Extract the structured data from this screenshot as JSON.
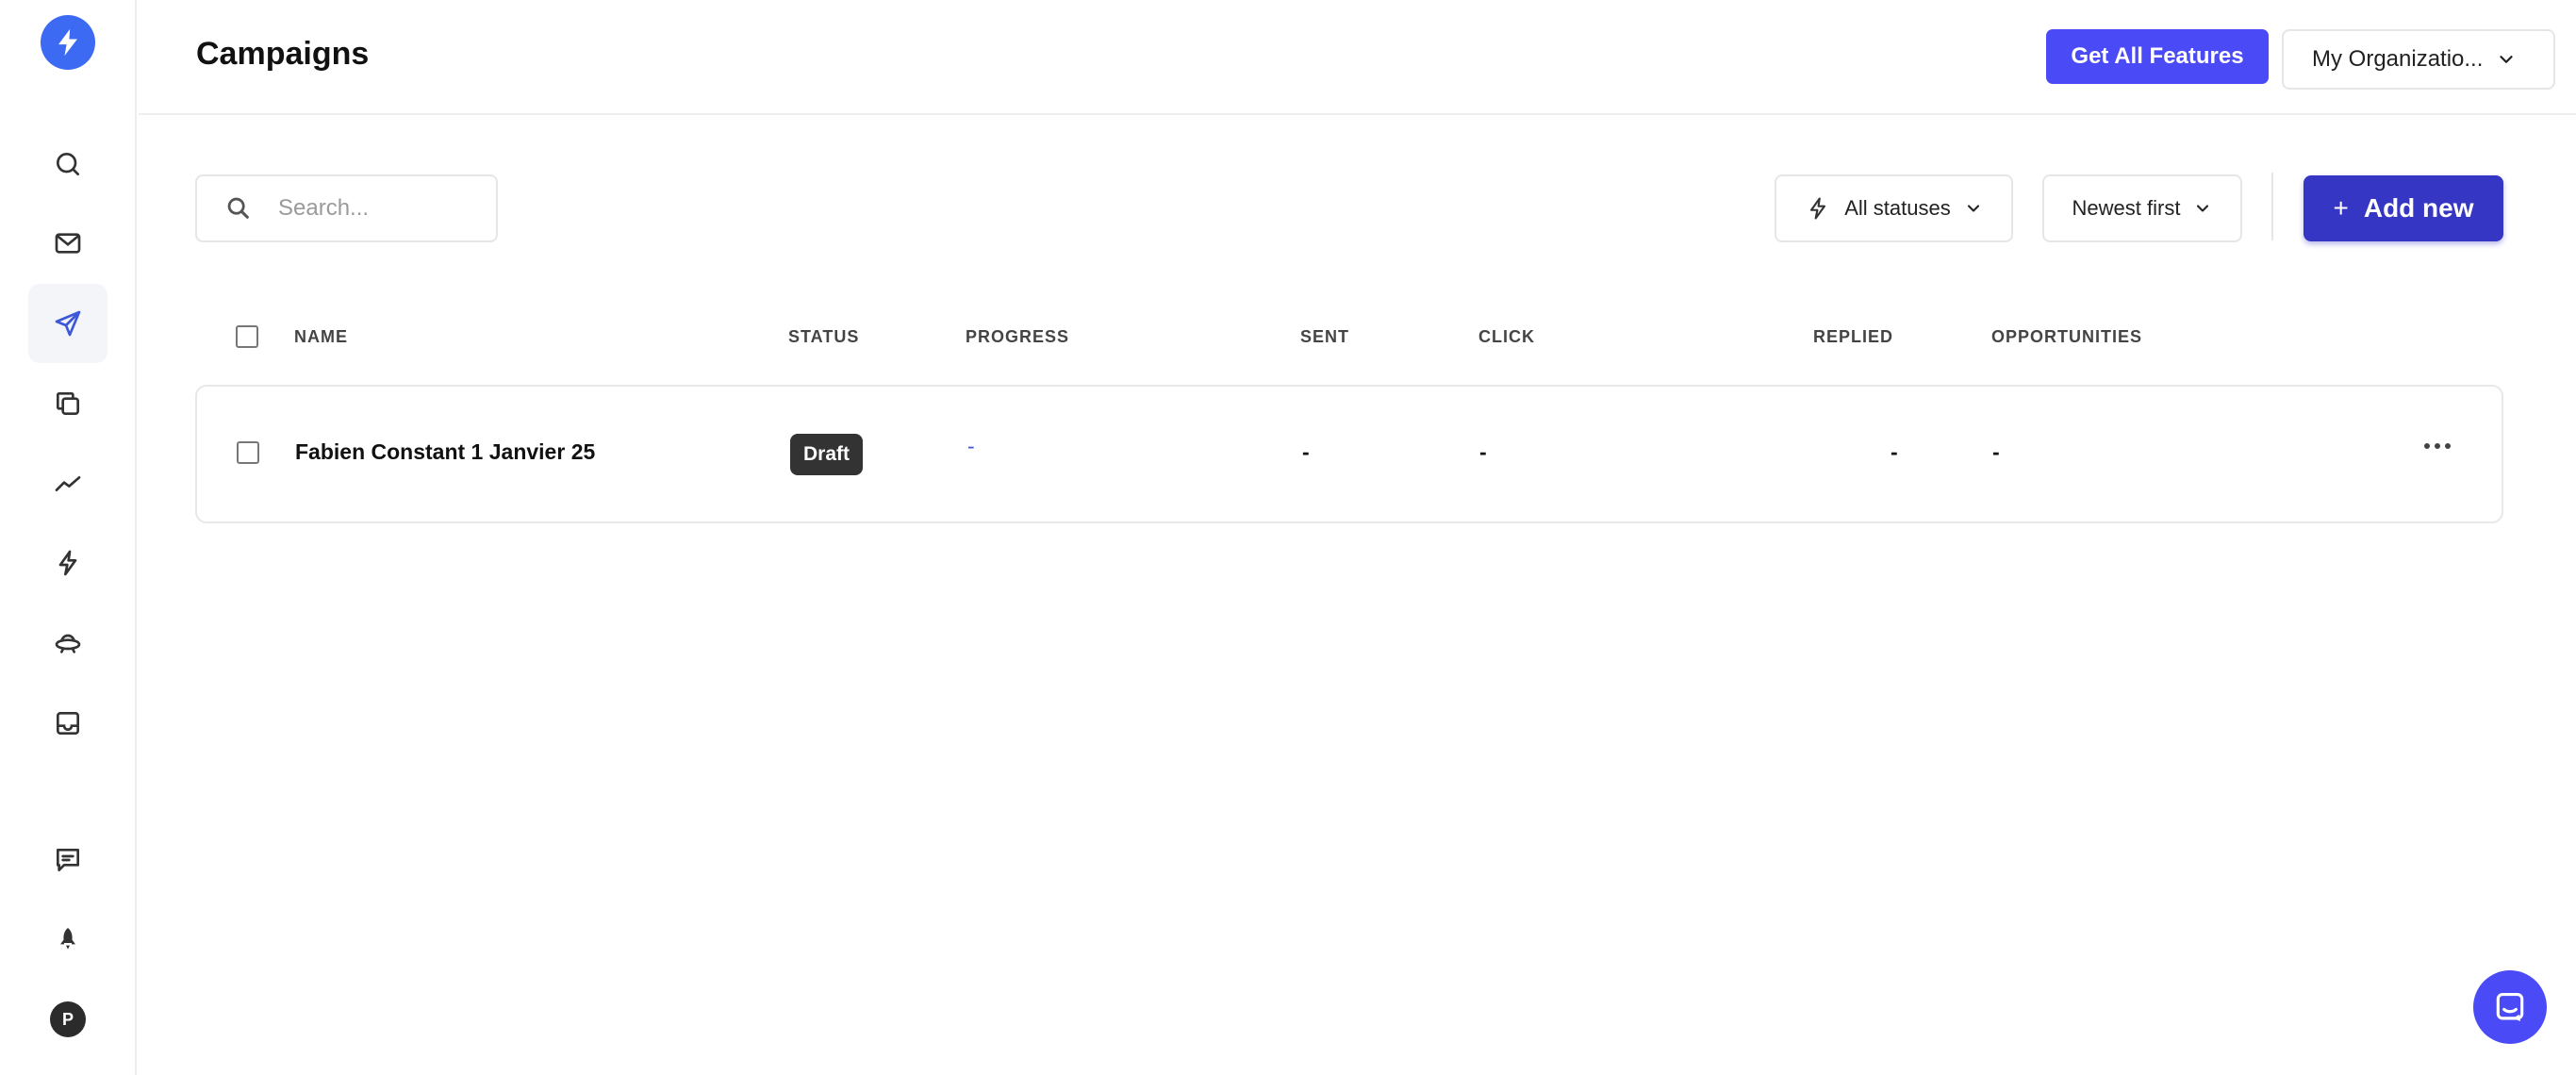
{
  "app": {
    "page_title": "Campaigns"
  },
  "sidebar": {
    "items": [
      {
        "name": "search-icon"
      },
      {
        "name": "mail-icon"
      },
      {
        "name": "send-icon",
        "active": true
      },
      {
        "name": "copy-icon"
      },
      {
        "name": "analytics-icon"
      },
      {
        "name": "lightning-icon"
      },
      {
        "name": "ufo-icon"
      },
      {
        "name": "inbox-icon"
      },
      {
        "name": "feedback-icon"
      },
      {
        "name": "rocket-icon"
      }
    ],
    "avatar_initial": "P"
  },
  "header": {
    "features_label": "Get All Features",
    "org_label": "My Organizatio..."
  },
  "toolbar": {
    "search_placeholder": "Search...",
    "status_filter": "All statuses",
    "sort_filter": "Newest first",
    "add_label": "Add new"
  },
  "table": {
    "headers": {
      "name": "NAME",
      "status": "STATUS",
      "progress": "PROGRESS",
      "sent": "SENT",
      "click": "CLICK",
      "replied": "REPLIED",
      "opportunities": "OPPORTUNITIES"
    },
    "rows": [
      {
        "name": "Fabien Constant 1 Janvier 25",
        "status": "Draft",
        "progress": "-",
        "sent": "-",
        "click": "-",
        "replied": "-",
        "opportunities": "-"
      }
    ]
  },
  "colors": {
    "brand": "#3d6af3",
    "primary_button": "#4a4bf6",
    "add_button": "#3536c4",
    "draft_badge": "#333333"
  }
}
